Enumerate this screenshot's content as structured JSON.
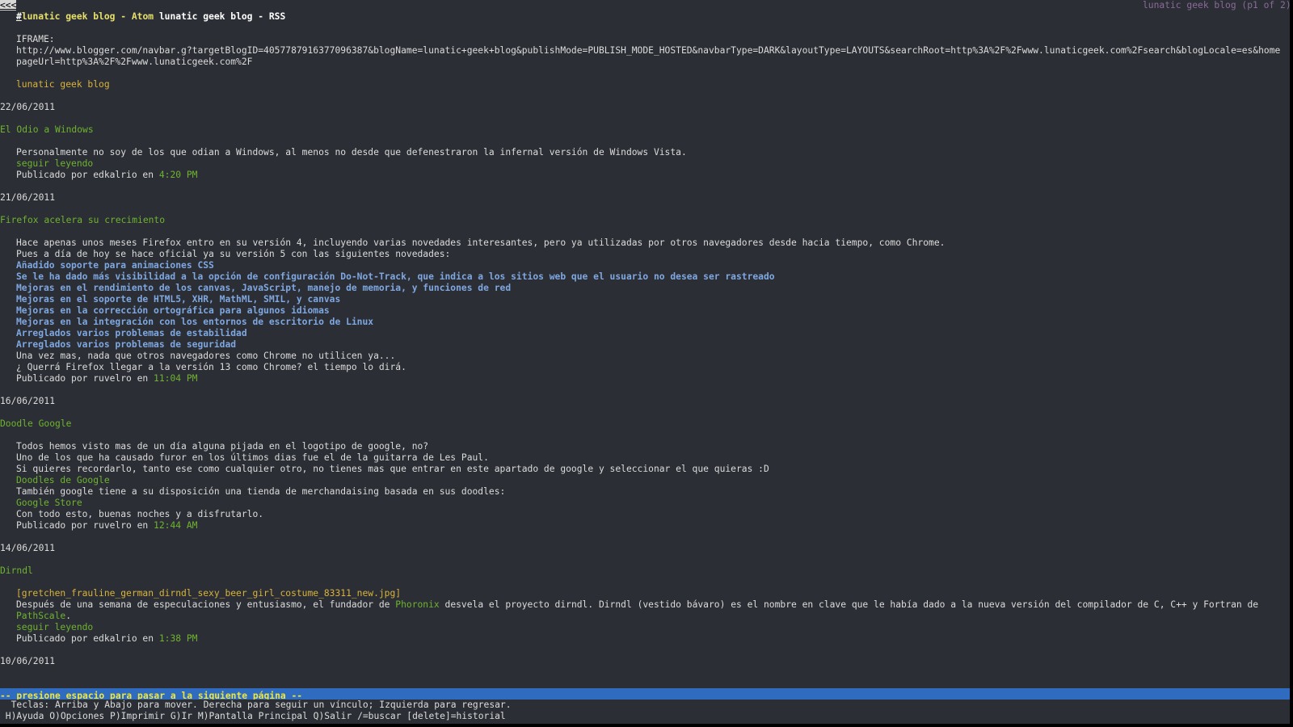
{
  "header": {
    "back_link": "<<<",
    "hash": "#",
    "atom_link": "lunatic geek blog - Atom",
    "rss_link": "lunatic geek blog - RSS",
    "page_indicator": "lunatic geek blog (p1 of 2)"
  },
  "iframe": {
    "label": "IFRAME:",
    "url_line1": "http://www.blogger.com/navbar.g?targetBlogID=4057787916377096387&blogName=lunatic+geek+blog&publishMode=PUBLISH_MODE_HOSTED&navbarType=DARK&layoutType=LAYOUTS&searchRoot=http%3A%2F%2Fwww.lunaticgeek.com%2Fsearch&blogLocale=es&home",
    "url_line2": "pageUrl=http%3A%2F%2Fwww.lunaticgeek.com%2F"
  },
  "blog_title": "lunatic geek blog",
  "posts": [
    {
      "date": "22/06/2011",
      "title": "El Odio a Windows",
      "body": [
        "Personalmente no soy de los que odian a Windows, al menos no desde que defenestraron la infernal versión de Windows Vista."
      ],
      "read_more": "seguir leyendo",
      "byline_prefix": "Publicado por edkalrio en ",
      "time": "4:20 PM"
    },
    {
      "date": "21/06/2011",
      "title": "Firefox acelera su crecimiento",
      "body": [
        "Hace apenas unos meses Firefox entro en su versión 4, incluyendo varias novedades interesantes, pero ya utilizadas por otros navegadores desde hacia tiempo, como Chrome.",
        "Pues a día de hoy se hace oficial ya su versión 5 con las siguientes novedades:"
      ],
      "features": [
        "Añadido soporte para animaciones CSS",
        "Se le ha dado más visibilidad a la opción de configuración Do-Not-Track, que indica a los sitios web que el usuario no desea ser rastreado",
        "Mejoras en el rendimiento de los canvas, JavaScript, manejo de memoria, y funciones de red",
        "Mejoras en el soporte de HTML5, XHR, MathML, SMIL, y canvas",
        "Mejoras en la corrección ortográfica para algunos idiomas",
        "Mejoras en la integración con los entornos de escritorio de Linux",
        "Arreglados varios problemas de estabilidad",
        "Arreglados varios problemas de seguridad"
      ],
      "closing": [
        "Una vez mas, nada que otros navegadores como Chrome no utilicen ya...",
        "¿ Querrá Firefox llegar a la versión 13 como Chrome? el tiempo lo dirá."
      ],
      "byline_prefix": "Publicado por ruvelro en ",
      "time": "11:04 PM"
    },
    {
      "date": "16/06/2011",
      "title": "Doodle Google",
      "body": [
        "Todos hemos visto mas de un día alguna pijada en el logotipo de google, no?",
        "Uno de los que ha causado furor en los últimos dias fue el de la guitarra de Les Paul.",
        "Si quieres recordarlo, tanto ese como cualquier otro, no tienes mas que entrar en este apartado de google y seleccionar el que quieras :D"
      ],
      "link1": "Doodles de Google",
      "middle": "También google tiene a su disposición una tienda de merchandaising basada en sus doodles:",
      "link2": "Google Store",
      "closing": "Con todo esto, buenas noches y a disfrutarlo.",
      "byline_prefix": "Publicado por ruvelro en ",
      "time": "12:44 AM"
    },
    {
      "date": "14/06/2011",
      "title": "Dirndl",
      "image_alt": "[gretchen_frauline_german_dirndl_sexy_beer_girl_costume_83311_new.jpg]",
      "body_pre": "Después de una semana de especulaciones y entusiasmo, el fundador de ",
      "phoronix_link": "Phoronix",
      "body_post": " desvela el proyecto dirndl. Dirndl (vestido bávaro) es el nombre en clave que le había dado a la nueva versión del compilador de C, C++ y Fortran de",
      "pathscale_link": "PathScale",
      "pathscale_end": ".",
      "read_more": "seguir leyendo",
      "byline_prefix": "Publicado por edkalrio en ",
      "time": "1:38 PM"
    },
    {
      "date": "10/06/2011"
    }
  ],
  "status_bar": "-- presione espacio para pasar a la siguiente página --",
  "help_line1": "  Teclas: Arriba y Abajo para mover. Derecha para seguir un vínculo; Izquierda para regresar.",
  "help_line2": " H)Ayuda O)Opciones P)Imprimir G)Ir M)Pantalla Principal Q)Salir /=buscar [delete]=historial",
  "colors": {
    "background": "#2b2e34",
    "text": "#dcdcdc",
    "link_green": "#6fb331",
    "link_orange": "#d9b33d",
    "list_blue": "#7fa7e0",
    "status_bar_bg": "#2f6cc0",
    "status_bar_text": "#f0e63c",
    "page_indicator": "#8a6a99"
  }
}
